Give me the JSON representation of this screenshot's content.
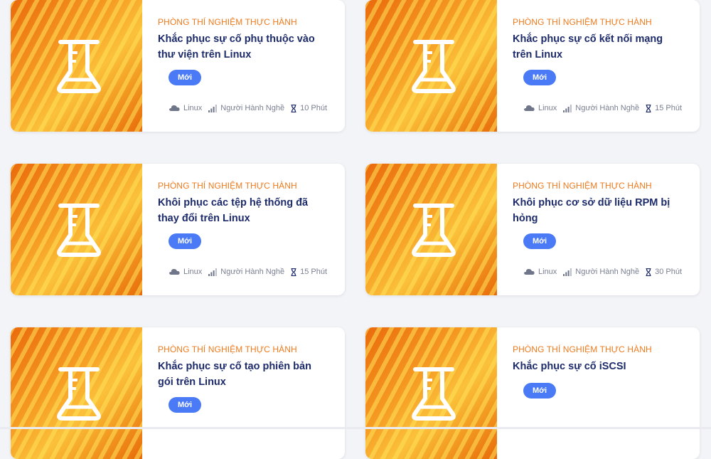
{
  "cards": [
    {
      "category": "PHÒNG THÍ NGHIỆM THỰC HÀNH",
      "title_line1": "Khắc phục sự cố phụ thuộc vào",
      "title_line2": "thư viện trên Linux",
      "badge": "Mới",
      "os": "Linux",
      "level": "Người Hành Nghề",
      "duration": "10 Phút"
    },
    {
      "category": "PHÒNG THÍ NGHIỆM THỰC HÀNH",
      "title_line1": "Khắc phục sự cố kết nối mạng",
      "title_line2": "trên Linux",
      "badge": "Mới",
      "os": "Linux",
      "level": "Người Hành Nghề",
      "duration": "15 Phút"
    },
    {
      "category": "PHÒNG THÍ NGHIỆM THỰC HÀNH",
      "title_line1": "Khôi phục các tệp hệ thống đã",
      "title_line2": "thay đổi trên Linux",
      "badge": "Mới",
      "os": "Linux",
      "level": "Người Hành Nghề",
      "duration": "15 Phút"
    },
    {
      "category": "PHÒNG THÍ NGHIỆM THỰC HÀNH",
      "title_line1": "Khôi phục cơ sở dữ liệu RPM bị",
      "title_line2": "hỏng",
      "badge": "Mới",
      "os": "Linux",
      "level": "Người Hành Nghề",
      "duration": "30 Phút"
    },
    {
      "category": "PHÒNG THÍ NGHIỆM THỰC HÀNH",
      "title_line1": "Khắc phục sự cố tạo phiên bản",
      "title_line2": "gói trên Linux",
      "badge": "Mới"
    },
    {
      "category": "PHÒNG THÍ NGHIỆM THỰC HÀNH",
      "title_line1": "Khắc phục sự cố iSCSI",
      "badge": "Mới"
    }
  ],
  "colors": {
    "category": "#ee7a1d",
    "title": "#1d2b6b",
    "badge": "#4a7af5",
    "thumb_icon": "#ffffff"
  },
  "icons": {
    "thumb": "flask-icon",
    "os": "cloud-icon",
    "level": "signal-bars-icon",
    "duration": "hourglass-icon"
  }
}
